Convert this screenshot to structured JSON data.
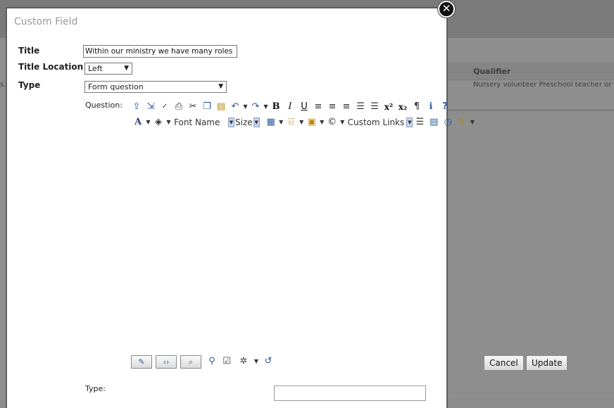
{
  "dialog": {
    "title": "Custom Field",
    "close_icon": "close-icon",
    "fields": {
      "title_label": "Title",
      "title_value": "Within our ministry we have many roles",
      "title_location_label": "Title Location",
      "title_location_value": "Left",
      "type_label": "Type",
      "type_value": "Form question",
      "question_label": "Question:",
      "type_sub_label": "Type:"
    },
    "editor": {
      "toolbar_row1": [
        "paste-from-word-icon",
        "paste-plain-icon",
        "spellcheck-icon",
        "print-icon",
        "cut-icon",
        "copy-icon",
        "paste-icon",
        "undo-icon",
        "redo-icon",
        "bold-icon",
        "italic-icon",
        "underline-icon",
        "align-left-icon",
        "align-center-icon",
        "align-right-icon",
        "justify-icon",
        "justify-none-icon",
        "superscript-icon",
        "subscript-icon",
        "format-stripper-icon",
        "about-icon",
        "help-icon"
      ],
      "toolbar_row2": {
        "font_name_label": "Font Name",
        "size_label": "Size",
        "custom_links_label": "Custom Links"
      },
      "mode_buttons": [
        "design-mode-icon",
        "html-mode-icon",
        "preview-mode-icon"
      ]
    }
  },
  "background": {
    "grid_header": "Qualifier",
    "grid_cell": "Nursery volunteer Preschool teacher or assis",
    "stray_text": "s.",
    "cancel_button": "Cancel",
    "update_button": "Update"
  }
}
